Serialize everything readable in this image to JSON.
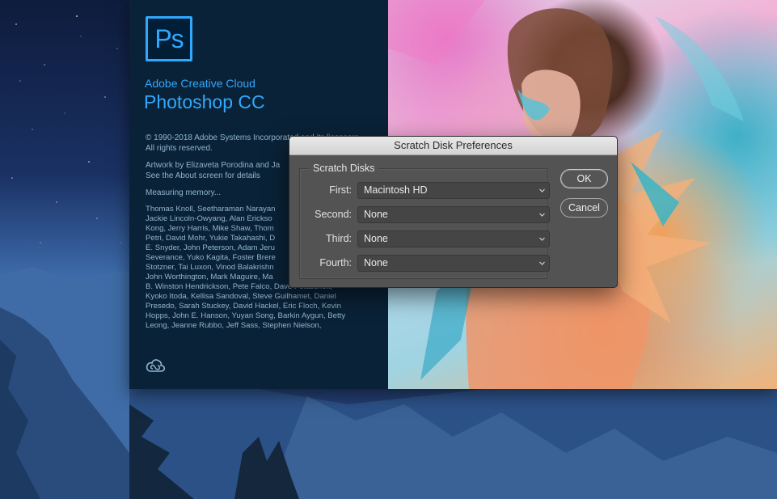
{
  "splash": {
    "logo_text": "Ps",
    "brand": "Adobe Creative Cloud",
    "product": "Photoshop CC",
    "copyright": [
      "© 1990-2018 Adobe Systems Incorporated and its licensors.",
      "All rights reserved."
    ],
    "artwork_credit": [
      "Artwork by Elizaveta Porodina and Ja",
      "See the About screen for details"
    ],
    "status": "Measuring memory...",
    "credits_lines": [
      "Thomas Knoll, Seetharaman Narayan",
      "Jackie Lincoln-Owyang, Alan Erickso",
      "Kong, Jerry Harris, Mike Shaw, Thom",
      "Petri, David Mohr, Yukie Takahashi, D",
      "E. Snyder, John Peterson, Adam Jeru",
      "Severance, Yuko Kagita, Foster Brere",
      "Stotzner, Tai Luxon, Vinod Balakrishn",
      "John Worthington, Mark Maguire, Ma",
      "B. Winston Hendrickson, Pete Falco, Dave Polaschek,",
      "Kyoko Itoda, Kellisa Sandoval, Steve Guilhamet, Daniel",
      "Presedo, Sarah Stuckey, David Hackel, Eric Floch, Kevin",
      "Hopps, John E. Hanson, Yuyan Song, Barkin Aygun, Betty",
      "Leong, Jeanne Rubbo, Jeff Sass, Stephen Nielson,"
    ],
    "cc_icon": "creative-cloud-icon",
    "accent_color": "#31a8ff"
  },
  "dialog": {
    "title": "Scratch Disk Preferences",
    "group_label": "Scratch Disks",
    "rows": [
      {
        "label": "First:",
        "value": "Macintosh HD"
      },
      {
        "label": "Second:",
        "value": "None"
      },
      {
        "label": "Third:",
        "value": "None"
      },
      {
        "label": "Fourth:",
        "value": "None"
      }
    ],
    "ok_label": "OK",
    "cancel_label": "Cancel"
  }
}
